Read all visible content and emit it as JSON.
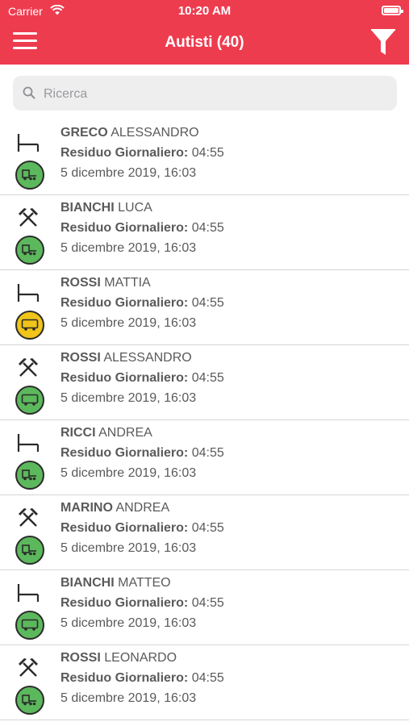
{
  "status_bar": {
    "carrier": "Carrier",
    "time": "10:20 AM"
  },
  "header": {
    "title": "Autisti (40)",
    "bg_color": "#ee3c4f"
  },
  "search": {
    "placeholder": "Ricerca",
    "value": ""
  },
  "colors": {
    "green": "#5cb85c",
    "yellow": "#f0c419"
  },
  "drivers": [
    {
      "last_name": "GRECO",
      "first_name": "ALESSANDRO",
      "residuo_label": "Residuo Giornaliero:",
      "residuo_value": "04:55",
      "date": "5 dicembre 2019, 16:03",
      "activity_icon": "bed-icon",
      "vehicle_icon": "truck-icon",
      "vehicle_color": "green"
    },
    {
      "last_name": "BIANCHI",
      "first_name": "LUCA",
      "residuo_label": "Residuo Giornaliero:",
      "residuo_value": "04:55",
      "date": "5 dicembre 2019, 16:03",
      "activity_icon": "hammers-icon",
      "vehicle_icon": "truck-icon",
      "vehicle_color": "green"
    },
    {
      "last_name": "ROSSI",
      "first_name": "MATTIA",
      "residuo_label": "Residuo Giornaliero:",
      "residuo_value": "04:55",
      "date": "5 dicembre 2019, 16:03",
      "activity_icon": "bed-icon",
      "vehicle_icon": "van-icon",
      "vehicle_color": "yellow"
    },
    {
      "last_name": "ROSSI",
      "first_name": "ALESSANDRO",
      "residuo_label": "Residuo Giornaliero:",
      "residuo_value": "04:55",
      "date": "5 dicembre 2019, 16:03",
      "activity_icon": "hammers-icon",
      "vehicle_icon": "van-icon",
      "vehicle_color": "green"
    },
    {
      "last_name": "RICCI",
      "first_name": "ANDREA",
      "residuo_label": "Residuo Giornaliero:",
      "residuo_value": "04:55",
      "date": "5 dicembre 2019, 16:03",
      "activity_icon": "bed-icon",
      "vehicle_icon": "truck-icon",
      "vehicle_color": "green"
    },
    {
      "last_name": "MARINO",
      "first_name": "ANDREA",
      "residuo_label": "Residuo Giornaliero:",
      "residuo_value": "04:55",
      "date": "5 dicembre 2019, 16:03",
      "activity_icon": "hammers-icon",
      "vehicle_icon": "truck-icon",
      "vehicle_color": "green"
    },
    {
      "last_name": "BIANCHI",
      "first_name": "MATTEO",
      "residuo_label": "Residuo Giornaliero:",
      "residuo_value": "04:55",
      "date": "5 dicembre 2019, 16:03",
      "activity_icon": "bed-icon",
      "vehicle_icon": "van-icon",
      "vehicle_color": "green"
    },
    {
      "last_name": "ROSSI",
      "first_name": "LEONARDO",
      "residuo_label": "Residuo Giornaliero:",
      "residuo_value": "04:55",
      "date": "5 dicembre 2019, 16:03",
      "activity_icon": "hammers-icon",
      "vehicle_icon": "truck-icon",
      "vehicle_color": "green"
    }
  ]
}
